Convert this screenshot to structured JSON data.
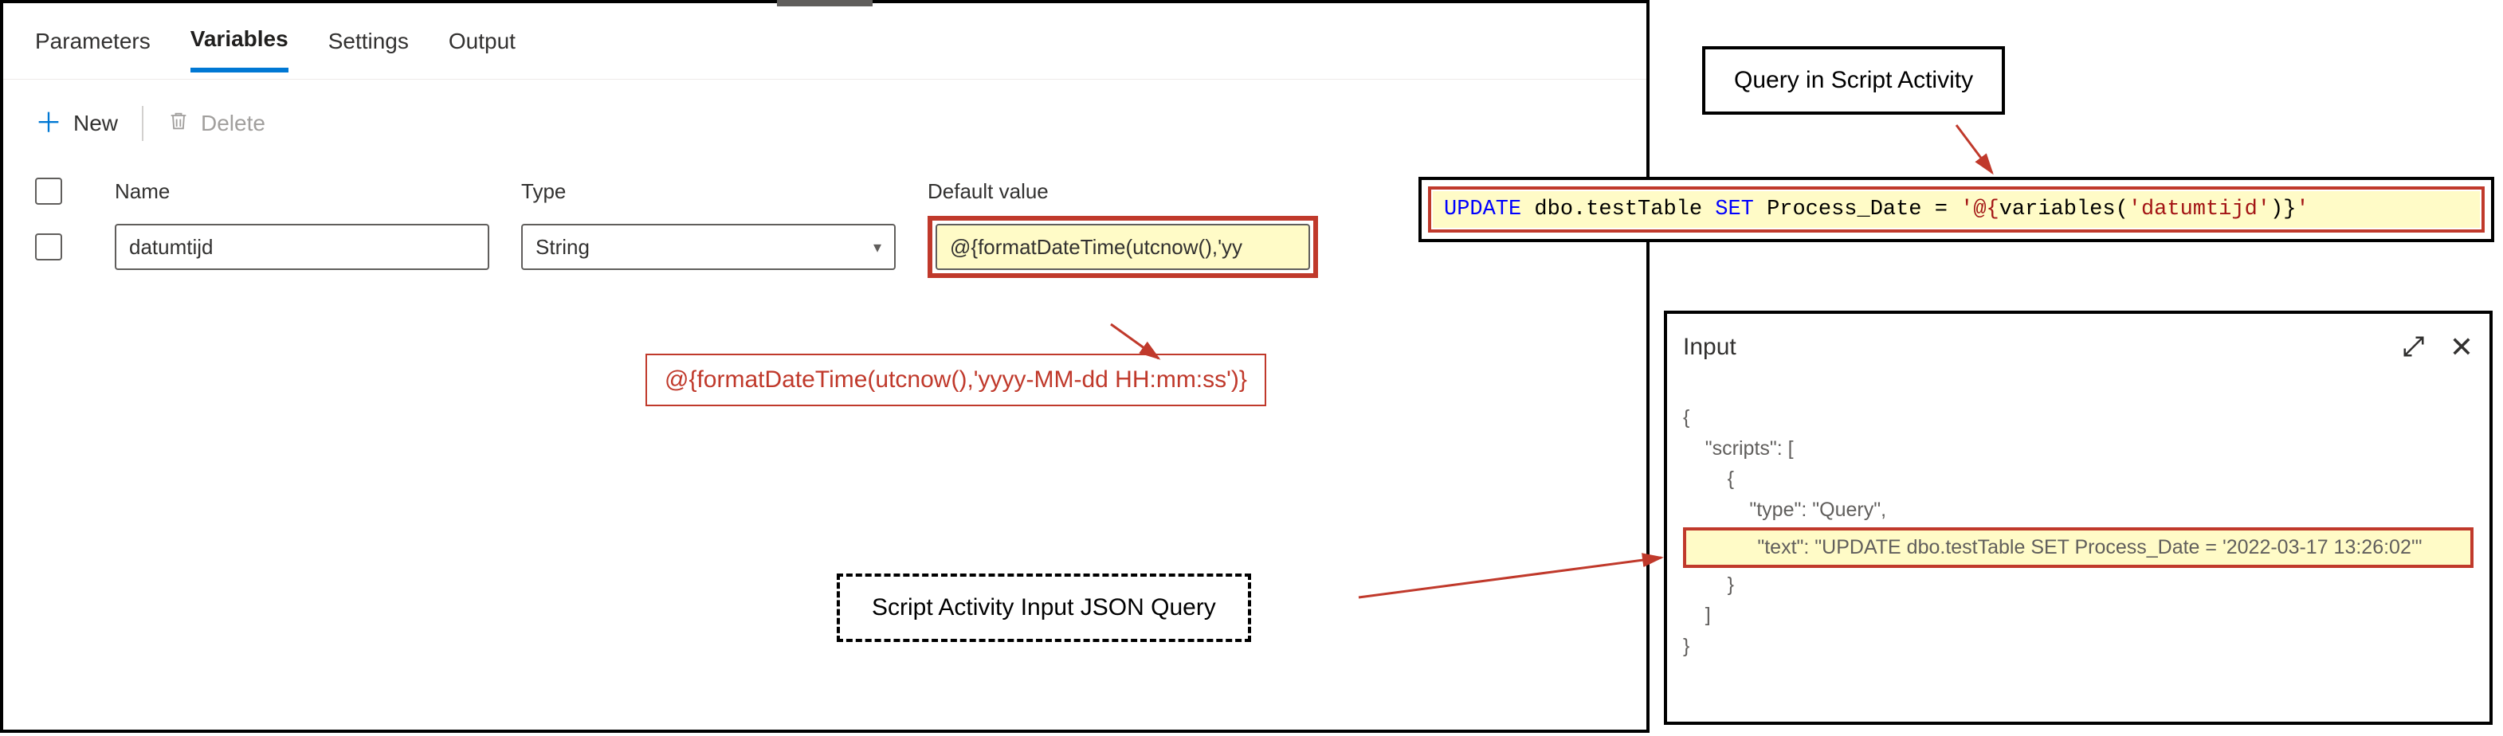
{
  "tabs": {
    "parameters": "Parameters",
    "variables": "Variables",
    "settings": "Settings",
    "output": "Output"
  },
  "toolbar": {
    "new_label": "New",
    "delete_label": "Delete"
  },
  "grid": {
    "header_name": "Name",
    "header_type": "Type",
    "header_default": "Default value",
    "rows": [
      {
        "name": "datumtijd",
        "type": "String",
        "default_value_truncated": "@{formatDateTime(utcnow(),'yy"
      }
    ]
  },
  "expression_full": "@{formatDateTime(utcnow(),'yyyy-MM-dd HH:mm:ss')}",
  "labels": {
    "query_activity": "Query in Script Activity",
    "json_query": "Script Activity Input JSON Query"
  },
  "sql_query": {
    "prefix": "UPDATE",
    "table": " dbo.testTable ",
    "set_kw": "SET",
    "col": " Process_Date = ",
    "q1": "'@{",
    "func": "variables",
    "open": "(",
    "arg": "'datumtijd'",
    "close": ")}",
    "q2": "'"
  },
  "input_panel": {
    "title": "Input",
    "json_lines": {
      "l1": "{",
      "l2": "    \"scripts\": [",
      "l3": "        {",
      "l4": "            \"type\": \"Query\",",
      "l5_hi": "            \"text\": \"UPDATE dbo.testTable SET Process_Date = '2022-03-17 13:26:02'\"",
      "l6": "        }",
      "l7": "    ]",
      "l8": "}"
    }
  }
}
